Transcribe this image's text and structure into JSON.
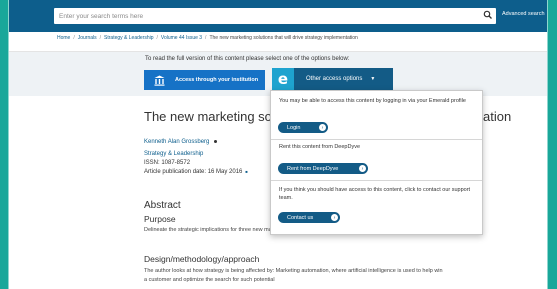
{
  "header": {
    "search_placeholder": "Enter your search terms here",
    "advanced_search": "Advanced search"
  },
  "breadcrumb": {
    "items": [
      "Home",
      "Journals",
      "Strategy & Leadership",
      "Volume 44 Issue 3",
      "The new marketing solutions that will drive strategy implementation"
    ]
  },
  "access": {
    "notice": "To read the full version of this content please select one of the options below:",
    "institution_button": "Access through your institution",
    "other_logo": "e",
    "other_button": "Other access options",
    "dropdown": {
      "login_text": "You may be able to access this content by logging in via your Emerald profile",
      "login_button": "Login",
      "rent_text": "Rent this content from DeepDyve",
      "rent_button": "Rent from DeepDyve",
      "contact_text": "If you think you should have access to this content, click to contact our support team.",
      "contact_button": "Contact us"
    }
  },
  "article": {
    "title_visible": "The new marketing solut",
    "title_tail": "ation",
    "author": "Kenneth Alan Grossberg",
    "journal": "Strategy & Leadership",
    "issn": "ISSN: 1087-8572",
    "pub_date": "Article publication date: 16 May 2016",
    "abstract_heading": "Abstract",
    "purpose_heading": "Purpose",
    "purpose_text": "Delineate the strategic implications for three new marketing trends based on digital technology.",
    "design_heading": "Design/methodology/approach",
    "design_text": "The author looks at how strategy is being affected by: Marketing automation, where artificial intelligence is used to help win a customer and optimize the search for such potential"
  },
  "colors": {
    "background": "#19a79a",
    "header": "#0d5e8c",
    "primary_button": "#1672c6",
    "dark_button": "#135b86"
  }
}
